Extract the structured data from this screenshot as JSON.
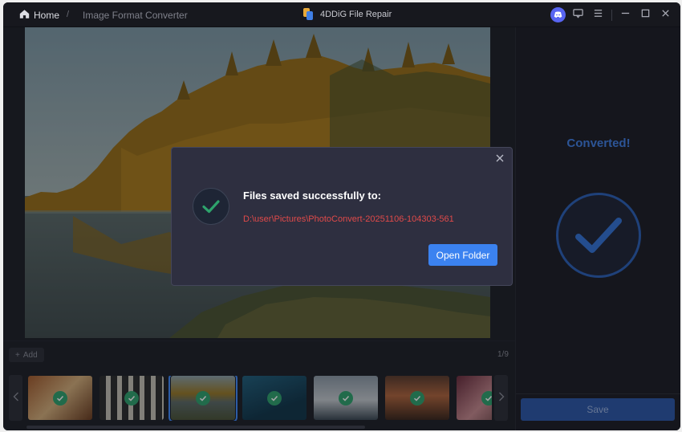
{
  "header": {
    "home_label": "Home",
    "separator": "/",
    "breadcrumb": "Image Format Converter",
    "app_title": "4DDiG File Repair",
    "icons": [
      "discord-icon",
      "feedback-icon",
      "menu-icon",
      "minimize-icon",
      "maximize-icon",
      "close-icon"
    ]
  },
  "toolbar": {
    "add_label": "Add",
    "page_counter": "1/9"
  },
  "thumbnails": {
    "items": [
      {
        "name": "food",
        "status": "converted"
      },
      {
        "name": "arches",
        "status": "converted"
      },
      {
        "name": "lake-forest",
        "status": "converted",
        "selected": true
      },
      {
        "name": "underwater",
        "status": "converted"
      },
      {
        "name": "opera-house",
        "status": "converted"
      },
      {
        "name": "sunset-boat",
        "status": "converted"
      },
      {
        "name": "flowers",
        "status": "converted"
      }
    ]
  },
  "sidebar": {
    "status_title": "Converted!",
    "save_label": "Save"
  },
  "dialog": {
    "title": "Files saved successfully to:",
    "path": "D:\\user\\Pictures\\PhotoConvert-20251106-104303-561",
    "open_folder_label": "Open Folder"
  },
  "colors": {
    "accent": "#3b82f0",
    "success": "#2ea36c",
    "error_path": "#e04a4a",
    "converted_text": "#3f7fe6"
  }
}
